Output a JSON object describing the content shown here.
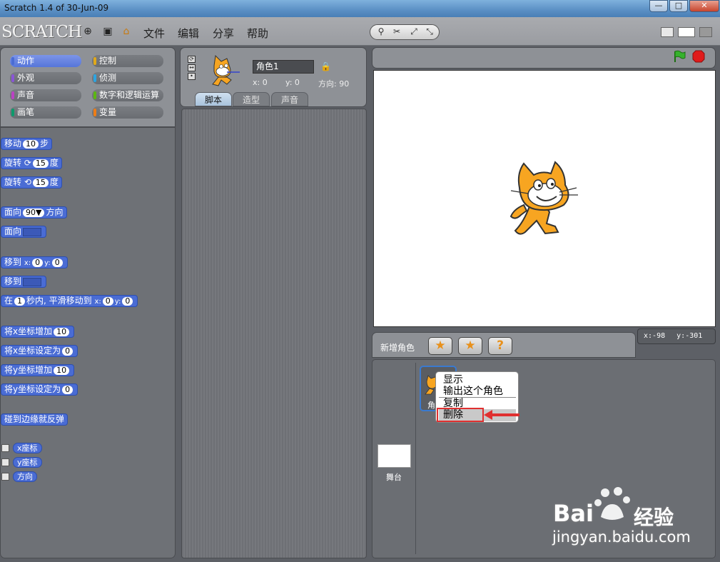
{
  "window": {
    "title": "Scratch 1.4 of 30-Jun-09",
    "btn_min": "—",
    "btn_max": "□",
    "btn_close": "✕"
  },
  "app": {
    "logo": "SCRATCH",
    "menus": [
      "文件",
      "编辑",
      "分享",
      "帮助"
    ],
    "icons": {
      "globe": "⊕",
      "save": "▣",
      "share": "⌂"
    },
    "tools": [
      "⚲",
      "✂",
      "⤢",
      "⤡"
    ]
  },
  "categories": {
    "left": [
      "动作",
      "外观",
      "声音",
      "画笔"
    ],
    "right": [
      "控制",
      "侦测",
      "数字和逻辑运算",
      "变量"
    ],
    "colors_left": [
      "#4a6cd4",
      "#8a55d7",
      "#bb42c3",
      "#0e9a6c"
    ],
    "colors_right": [
      "#e1a91a",
      "#2ca5e2",
      "#5cb712",
      "#ee7d16"
    ]
  },
  "blocks": {
    "move": {
      "label": "移动",
      "value": "10",
      "unit": "步"
    },
    "turn_right": {
      "label": "旋转",
      "value": "15",
      "unit": "度"
    },
    "turn_left": {
      "label": "旋转",
      "value": "15",
      "unit": "度"
    },
    "point_dir": {
      "label": "面向",
      "value": "90▼",
      "unit": "方向"
    },
    "point_to": {
      "label": "面向"
    },
    "goto_xy": {
      "label": "移到",
      "x_label": "x:",
      "x": "0",
      "y_label": "y:",
      "y": "0"
    },
    "goto": {
      "label": "移到"
    },
    "glide": {
      "pre": "在",
      "secs": "1",
      "mid": "秒内, 平滑移动到",
      "x_label": "x:",
      "x": "0",
      "y_label": "y:",
      "y": "0"
    },
    "change_x": {
      "label": "将x坐标增加",
      "value": "10"
    },
    "set_x": {
      "label": "将x坐标设定为",
      "value": "0"
    },
    "change_y": {
      "label": "将y坐标增加",
      "value": "10"
    },
    "set_y": {
      "label": "将y坐标设定为",
      "value": "0"
    },
    "bounce": {
      "label": "碰到边缘就反弹"
    },
    "reporters": [
      "x座标",
      "y座标",
      "方向"
    ]
  },
  "sprite": {
    "name": "角色1",
    "x_label": "x:",
    "x": "0",
    "y_label": "y:",
    "y": "0",
    "dir_label": "方向:",
    "dir": "90"
  },
  "tabs": [
    "脚本",
    "造型",
    "声音"
  ],
  "stage": {
    "mouse_x_label": "x:",
    "mouse_x": "-98",
    "mouse_y_label": "y:",
    "mouse_y": "-301"
  },
  "sprite_list": {
    "new_sprite_label": "新增角色",
    "sprite_caption": "角",
    "stage_label": "舞台"
  },
  "context_menu": [
    "显示",
    "输出这个角色",
    "复制",
    "删除"
  ],
  "watermark": {
    "brand": "Bai",
    "brand2": "经验",
    "url": "jingyan.baidu.com"
  }
}
